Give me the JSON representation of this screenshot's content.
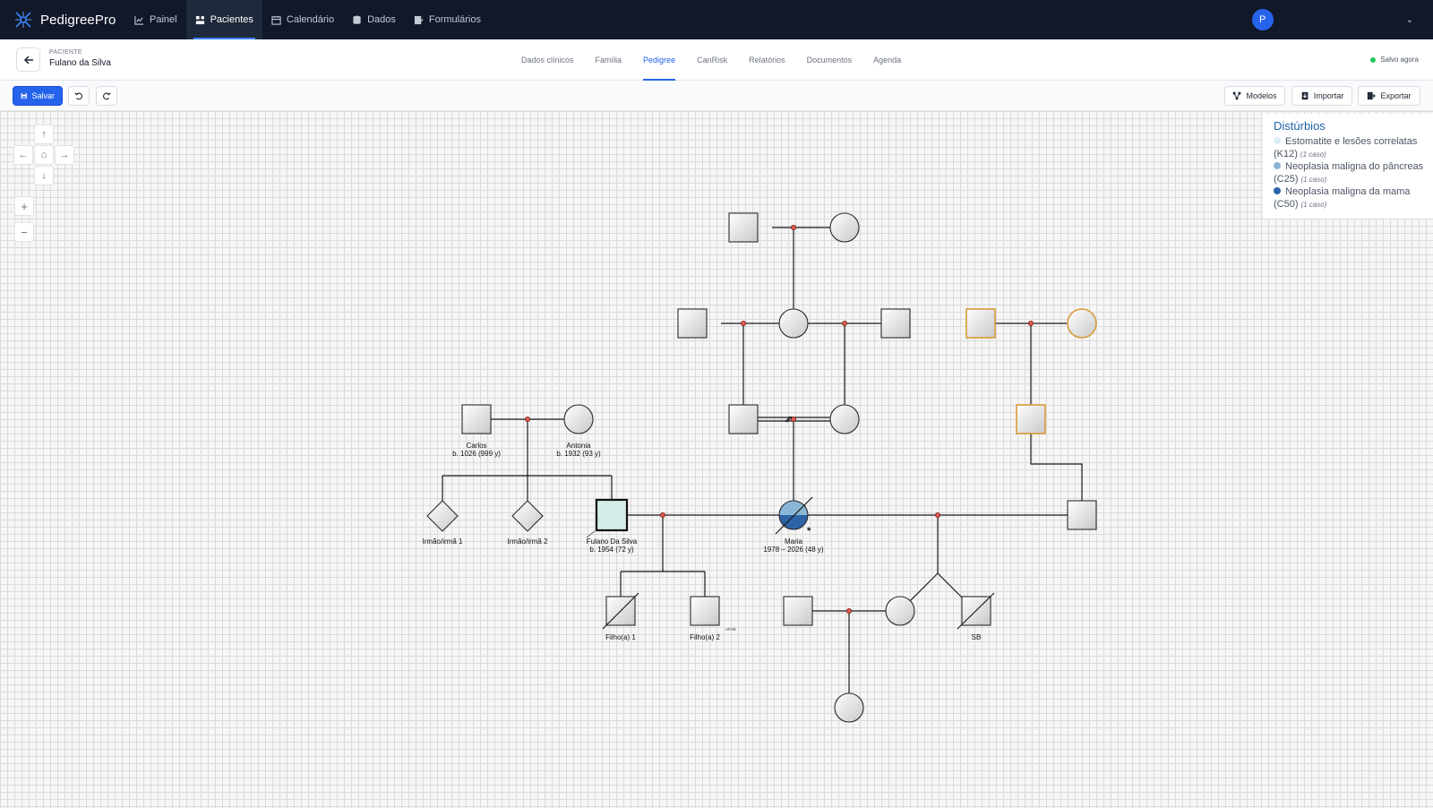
{
  "app": {
    "name": "PedigreePro"
  },
  "nav": {
    "items": [
      {
        "label": "Painel",
        "icon": "chart-line-icon"
      },
      {
        "label": "Pacientes",
        "icon": "patients-icon"
      },
      {
        "label": "Calendário",
        "icon": "calendar-icon"
      },
      {
        "label": "Dados",
        "icon": "database-icon"
      },
      {
        "label": "Formulários",
        "icon": "form-icon"
      }
    ],
    "active": "Pacientes"
  },
  "user": {
    "initial": "P"
  },
  "patient": {
    "label": "PACIENTE",
    "name": "Fulano da Silva"
  },
  "tabs": [
    {
      "label": "Dados clínicos"
    },
    {
      "label": "Família"
    },
    {
      "label": "Pedigree"
    },
    {
      "label": "CanRisk"
    },
    {
      "label": "Relatórios"
    },
    {
      "label": "Documentos"
    },
    {
      "label": "Agenda"
    }
  ],
  "active_tab": "Pedigree",
  "save_status": "Salvo agora",
  "toolbar": {
    "save_label": "Salvar",
    "models_label": "Modelos",
    "import_label": "Importar",
    "export_label": "Exportar"
  },
  "controls": {
    "up": "↑",
    "left": "←",
    "home": "⌂",
    "right": "→",
    "down": "↓",
    "zoom_in": "+",
    "zoom_out": "−"
  },
  "legend": {
    "title": "Distúrbios",
    "items": [
      {
        "label": "Estomatite e lesões correlatas (K12)",
        "cases": "(1 caso)",
        "color": "#dbeef5"
      },
      {
        "label": "Neoplasia maligna do pâncreas (C25)",
        "cases": "(1 caso)",
        "color": "#8ab6d6"
      },
      {
        "label": "Neoplasia maligna da mama (C50)",
        "cases": "(1 caso)",
        "color": "#2d64a8"
      }
    ]
  },
  "pedigree_labels": {
    "carlos_name": "Carlos",
    "carlos_birth": "b. 1026 (999 y)",
    "antonia_name": "Antonia",
    "antonia_birth": "b. 1932 (93 y)",
    "sib1": "Irmão/irmã 1",
    "sib2": "Irmão/irmã 2",
    "proband_name": "Fulano Da Silva",
    "proband_birth": "b. 1954 (72 y)",
    "maria_name": "Maria",
    "maria_dates": "1978 – 2026 (48 y)",
    "child1": "Filho(a) 1",
    "child2": "Filho(a) 2",
    "child2_note": "AFAB",
    "sb": "SB",
    "maria_marker": "*"
  },
  "colors": {
    "nav_bg": "#101829",
    "accent": "#2563eb",
    "status_ok": "#22c55e",
    "proband_fill": "#d5ece8",
    "highlight_border": "#d99a3a"
  }
}
